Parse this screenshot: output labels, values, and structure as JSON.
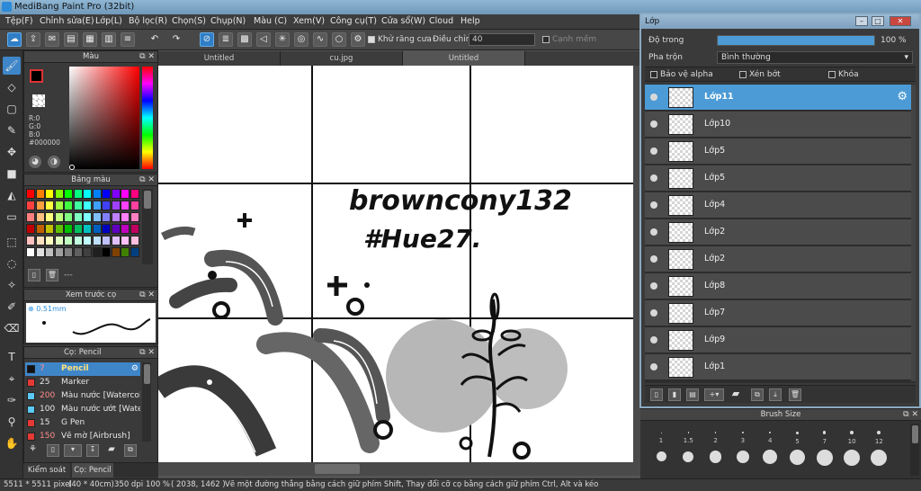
{
  "window": {
    "title": "MediBang Paint Pro (32bit)"
  },
  "menu": [
    "Tệp(F)",
    "Chỉnh sửa(E)",
    "Lớp(L)",
    "Bộ lọc(R)",
    "Chọn(S)",
    "Chụp(N)",
    "Màu (C)",
    "Xem(V)",
    "Công cụ(T)",
    "Cửa sổ(W)",
    "Cloud",
    "Help"
  ],
  "toolbar": {
    "antialias_label": "Khử răng cưa",
    "adjust_label": "Điều chỉnh",
    "adjust_value": "40",
    "sharp_label": "Cạnh mềm"
  },
  "color_panel": {
    "title": "Màu",
    "r": "R:0",
    "g": "G:0",
    "b": "B:0",
    "hex": "#000000"
  },
  "palette_panel": {
    "title": "Bảng màu",
    "footer": "---",
    "swatches": [
      "#ff0000",
      "#ff8000",
      "#ffff00",
      "#80ff00",
      "#00ff00",
      "#00ff80",
      "#00ffff",
      "#0080ff",
      "#0000ff",
      "#8000ff",
      "#ff00ff",
      "#ff0080",
      "#ff4040",
      "#ffa040",
      "#ffff40",
      "#a0ff40",
      "#40ff40",
      "#40ffa0",
      "#40ffff",
      "#40a0ff",
      "#4040ff",
      "#a040ff",
      "#ff40ff",
      "#ff40a0",
      "#ff8080",
      "#ffc080",
      "#ffff80",
      "#c0ff80",
      "#80ff80",
      "#80ffc0",
      "#80ffff",
      "#80c0ff",
      "#8080ff",
      "#c080ff",
      "#ff80ff",
      "#ff80c0",
      "#c00000",
      "#c06000",
      "#c0c000",
      "#60c000",
      "#00c000",
      "#00c060",
      "#00c0c0",
      "#0060c0",
      "#0000c0",
      "#6000c0",
      "#c000c0",
      "#c00060",
      "#ffc0c0",
      "#ffe0c0",
      "#ffffc0",
      "#e0ffc0",
      "#c0ffc0",
      "#c0ffe0",
      "#c0ffff",
      "#c0e0ff",
      "#c0c0ff",
      "#e0c0ff",
      "#ffc0ff",
      "#ffc0e0",
      "#ffffff",
      "#e0e0e0",
      "#c0c0c0",
      "#a0a0a0",
      "#808080",
      "#606060",
      "#404040",
      "#202020",
      "#000000",
      "#804000",
      "#408000",
      "#004080"
    ]
  },
  "preview_panel": {
    "title": "Xem trước cọ",
    "size": "0.51mm"
  },
  "brush_panel": {
    "title": "Cọ: Pencil",
    "brushes": [
      {
        "num": "7",
        "name": "Pencil",
        "color": "#111111"
      },
      {
        "num": "25",
        "name": "Marker",
        "color": "#e53935"
      },
      {
        "num": "200",
        "name": "Màu nước [Watercolor]",
        "color": "#5bc8f5"
      },
      {
        "num": "100",
        "name": "Màu nước ướt [Watercolor Wet]",
        "color": "#5bc8f5"
      },
      {
        "num": "15",
        "name": "G Pen",
        "color": "#e53935"
      },
      {
        "num": "150",
        "name": "Vẽ mờ [Airbrush]",
        "color": "#e53935"
      }
    ]
  },
  "bottom_tabs": [
    "Kiểm soát cọ",
    "Cọ: Pencil"
  ],
  "doc_tabs": [
    "Untitled",
    "cu.jpg",
    "Untitled"
  ],
  "canvas": {
    "handwriting_line1": "browncony132",
    "handwriting_line2": "#Hue27."
  },
  "layer_window": {
    "title": "Lớp",
    "opacity_label": "Độ trong",
    "opacity_value": "100 %",
    "opacity_fraction": 1.0,
    "blend_label": "Pha trộn",
    "blend_value": "Bình thường",
    "protect_alpha": "Bảo vệ alpha",
    "clipping": "Xén bớt",
    "lock": "Khóa",
    "layers": [
      {
        "name": "Lớp11",
        "selected": true
      },
      {
        "name": "Lớp10"
      },
      {
        "name": "Lớp5"
      },
      {
        "name": "Lớp5"
      },
      {
        "name": "Lớp4"
      },
      {
        "name": "Lớp2"
      },
      {
        "name": "Lớp2"
      },
      {
        "name": "Lớp8"
      },
      {
        "name": "Lớp7"
      },
      {
        "name": "Lớp9"
      },
      {
        "name": "Lớp1"
      }
    ]
  },
  "brush_size_panel": {
    "title": "Brush Size",
    "sizes": [
      "1",
      "1.5",
      "2",
      "3",
      "4",
      "5",
      "7",
      "10",
      "12"
    ]
  },
  "status": {
    "dims": "5511 * 5511 pixel",
    "physical": "(40 * 40cm)",
    "dpi": "350 dpi",
    "zoom": "100 %",
    "coords": "( 2038, 1462 )",
    "hint": "Vẽ một đường thẳng bằng cách giữ phím Shift, Thay đổi cỡ cọ bằng cách giữ phím Ctrl, Alt và kéo"
  }
}
